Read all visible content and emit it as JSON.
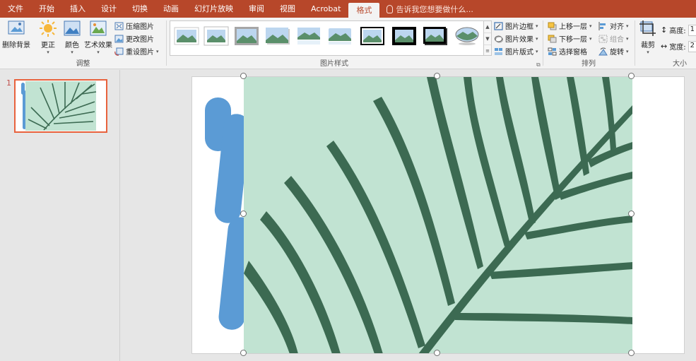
{
  "tabs": [
    {
      "label": "文件",
      "active": false
    },
    {
      "label": "开始",
      "active": false
    },
    {
      "label": "插入",
      "active": false
    },
    {
      "label": "设计",
      "active": false
    },
    {
      "label": "切换",
      "active": false
    },
    {
      "label": "动画",
      "active": false
    },
    {
      "label": "幻灯片放映",
      "active": false
    },
    {
      "label": "审阅",
      "active": false
    },
    {
      "label": "视图",
      "active": false
    },
    {
      "label": "Acrobat",
      "active": false
    },
    {
      "label": "格式",
      "active": true
    }
  ],
  "tellme": "告诉我您想要做什么...",
  "adjust": {
    "remove_bg": "删除背景",
    "corrections": "更正",
    "color": "颜色",
    "artistic": "艺术效果",
    "compress": "压缩图片",
    "change": "更改图片",
    "reset": "重设图片",
    "group_label": "调整"
  },
  "styles": {
    "border": "图片边框",
    "effects": "图片效果",
    "layout": "图片版式",
    "group_label": "图片样式"
  },
  "arrange": {
    "bring_forward": "上移一层",
    "send_backward": "下移一层",
    "selection_pane": "选择窗格",
    "align": "对齐",
    "group": "组合",
    "rotate": "旋转",
    "group_label": "排列"
  },
  "size": {
    "crop": "裁剪",
    "height": "高度:",
    "width": "宽度:",
    "height_value": "1",
    "width_value": "2",
    "group_label": "大小"
  },
  "slide": {
    "number": "1"
  },
  "colors": {
    "accent": "#b7472a",
    "selection": "#e8623d",
    "shape_blue": "#5b9bd5",
    "leaf_bg": "#c1e3d2",
    "leaf_dark": "#3c6a52"
  }
}
